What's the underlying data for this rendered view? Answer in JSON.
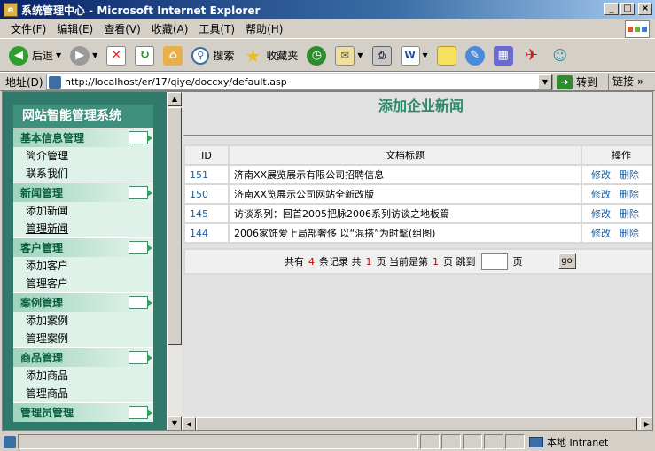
{
  "window": {
    "title": "系统管理中心 - Microsoft Internet Explorer",
    "controls": {
      "minimize": "_",
      "maximize": "□",
      "close": "×"
    }
  },
  "menu": {
    "items": [
      "文件(F)",
      "编辑(E)",
      "查看(V)",
      "收藏(A)",
      "工具(T)",
      "帮助(H)"
    ]
  },
  "toolbar": {
    "back_label": "后退",
    "search_label": "搜索",
    "favorites_label": "收藏夹"
  },
  "address": {
    "label": "地址(D)",
    "url": "http://localhost/er/17/qiye/doccxy/default.asp",
    "go_label": "转到",
    "links_label": "链接"
  },
  "sidebar": {
    "title": "网站智能管理系统",
    "groups": [
      {
        "label": "基本信息管理",
        "items": [
          "简介管理",
          "联系我们"
        ]
      },
      {
        "label": "新闻管理",
        "items": [
          "添加新闻",
          "管理新闻"
        ]
      },
      {
        "label": "客户管理",
        "items": [
          "添加客户",
          "管理客户"
        ]
      },
      {
        "label": "案例管理",
        "items": [
          "添加案例",
          "管理案例"
        ]
      },
      {
        "label": "商品管理",
        "items": [
          "添加商品",
          "管理商品"
        ]
      },
      {
        "label": "管理员管理",
        "items": []
      }
    ]
  },
  "main": {
    "heading": "添加企业新闻",
    "table": {
      "headers": [
        "ID",
        "文档标题",
        "操作"
      ],
      "rows": [
        {
          "id": "151",
          "title": "济南XX展览展示有限公司招聘信息",
          "edit": "修改",
          "delete": "删除"
        },
        {
          "id": "150",
          "title": "济南XX览展示公司网站全新改版",
          "edit": "修改",
          "delete": "删除"
        },
        {
          "id": "145",
          "title": "访谈系列：回首2005把脉2006系列访谈之地板篇",
          "edit": "修改",
          "delete": "删除"
        },
        {
          "id": "144",
          "title": "2006家饰爱上局部奢侈 以“混搭”为时髦(组图)",
          "edit": "修改",
          "delete": "删除"
        }
      ]
    },
    "pager": {
      "text_total_prefix": "共有",
      "total_records": "4",
      "text_records": "条记录 共",
      "total_pages": "1",
      "text_pages_current": "页 当前是第",
      "current_page": "1",
      "text_jump": "页 跳到",
      "text_page_suffix": "页",
      "go_label": "go"
    }
  },
  "status": {
    "zone": "本地 Intranet"
  }
}
